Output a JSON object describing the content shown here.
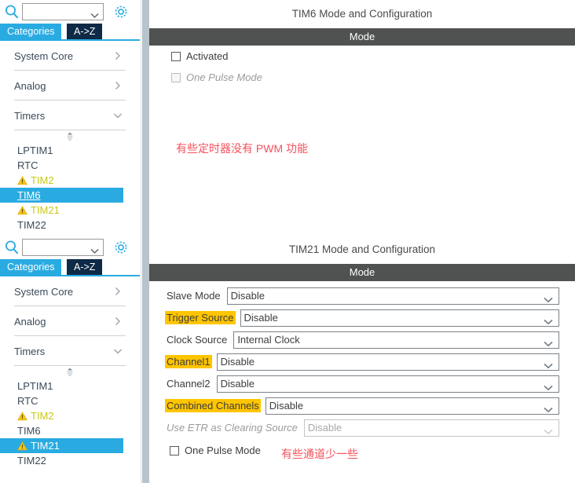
{
  "panels": [
    {
      "id": "tim6",
      "sidebar": {
        "search": {
          "value": "",
          "placeholder": ""
        },
        "icons": {
          "search": "search-icon",
          "gear": "gear-icon",
          "dropdown": "chevron-down-icon"
        },
        "tabs": [
          {
            "id": "categories",
            "label": "Categories",
            "selected": true
          },
          {
            "id": "a-to-z",
            "label": "A->Z",
            "selected": false
          }
        ],
        "categories": [
          {
            "label": "System Core",
            "expanded": false,
            "chevron": "chevron-right-icon"
          },
          {
            "label": "Analog",
            "expanded": false,
            "chevron": "chevron-right-icon"
          },
          {
            "label": "Timers",
            "expanded": true,
            "chevron": "chevron-down-icon"
          }
        ],
        "tree": [
          {
            "label": "LPTIM1",
            "warning": false,
            "selected": false
          },
          {
            "label": "RTC",
            "warning": false,
            "selected": false
          },
          {
            "label": "TIM2",
            "warning": true,
            "selected": false
          },
          {
            "label": "TIM6",
            "warning": false,
            "selected": true
          },
          {
            "label": "TIM21",
            "warning": true,
            "selected": false
          },
          {
            "label": "TIM22",
            "warning": false,
            "selected": false
          }
        ]
      },
      "content": {
        "title": "TIM6 Mode and Configuration",
        "mode_bar": "Mode",
        "checkboxes": [
          {
            "label": "Activated",
            "checked": false,
            "disabled": false
          },
          {
            "label": "One Pulse Mode",
            "checked": false,
            "disabled": true
          }
        ],
        "dropdowns": [],
        "annotation": "有些定时器没有 PWM 功能"
      }
    },
    {
      "id": "tim21",
      "sidebar": {
        "search": {
          "value": "",
          "placeholder": ""
        },
        "icons": {
          "search": "search-icon",
          "gear": "gear-icon",
          "dropdown": "chevron-down-icon"
        },
        "tabs": [
          {
            "id": "categories",
            "label": "Categories",
            "selected": true
          },
          {
            "id": "a-to-z",
            "label": "A->Z",
            "selected": false
          }
        ],
        "categories": [
          {
            "label": "System Core",
            "expanded": false,
            "chevron": "chevron-right-icon"
          },
          {
            "label": "Analog",
            "expanded": false,
            "chevron": "chevron-right-icon"
          },
          {
            "label": "Timers",
            "expanded": true,
            "chevron": "chevron-down-icon"
          }
        ],
        "tree": [
          {
            "label": "LPTIM1",
            "warning": false,
            "selected": false
          },
          {
            "label": "RTC",
            "warning": false,
            "selected": false
          },
          {
            "label": "TIM2",
            "warning": true,
            "selected": false
          },
          {
            "label": "TIM6",
            "warning": false,
            "selected": false
          },
          {
            "label": "TIM21",
            "warning": true,
            "selected": true
          },
          {
            "label": "TIM22",
            "warning": false,
            "selected": false
          }
        ]
      },
      "content": {
        "title": "TIM21 Mode and Configuration",
        "mode_bar": "Mode",
        "dropdowns": [
          {
            "label": "Slave Mode",
            "value": "Disable",
            "highlighted": false,
            "disabled": false
          },
          {
            "label": "Trigger Source",
            "value": "Disable",
            "highlighted": true,
            "disabled": false
          },
          {
            "label": "Clock Source",
            "value": "Internal Clock",
            "highlighted": false,
            "disabled": false
          },
          {
            "label": "Channel1",
            "value": "Disable",
            "highlighted": true,
            "disabled": false
          },
          {
            "label": "Channel2",
            "value": "Disable",
            "highlighted": false,
            "disabled": false
          },
          {
            "label": "Combined Channels",
            "value": "Disable",
            "highlighted": true,
            "disabled": false
          },
          {
            "label": "Use ETR as Clearing Source",
            "value": "Disable",
            "highlighted": false,
            "disabled": true
          }
        ],
        "checkboxes": [
          {
            "label": "One Pulse Mode",
            "checked": false,
            "disabled": false
          }
        ],
        "annotation": "有些通道少一些"
      }
    }
  ],
  "colors": {
    "accent_blue": "#29abe2",
    "tab_dark": "#0e2a47",
    "mode_bar": "#4f5250",
    "highlight_yellow": "#ffc500",
    "warning_yellow": "#f5c518",
    "annotation_red": "#f4515b",
    "splitter": "#b8c4cc"
  }
}
